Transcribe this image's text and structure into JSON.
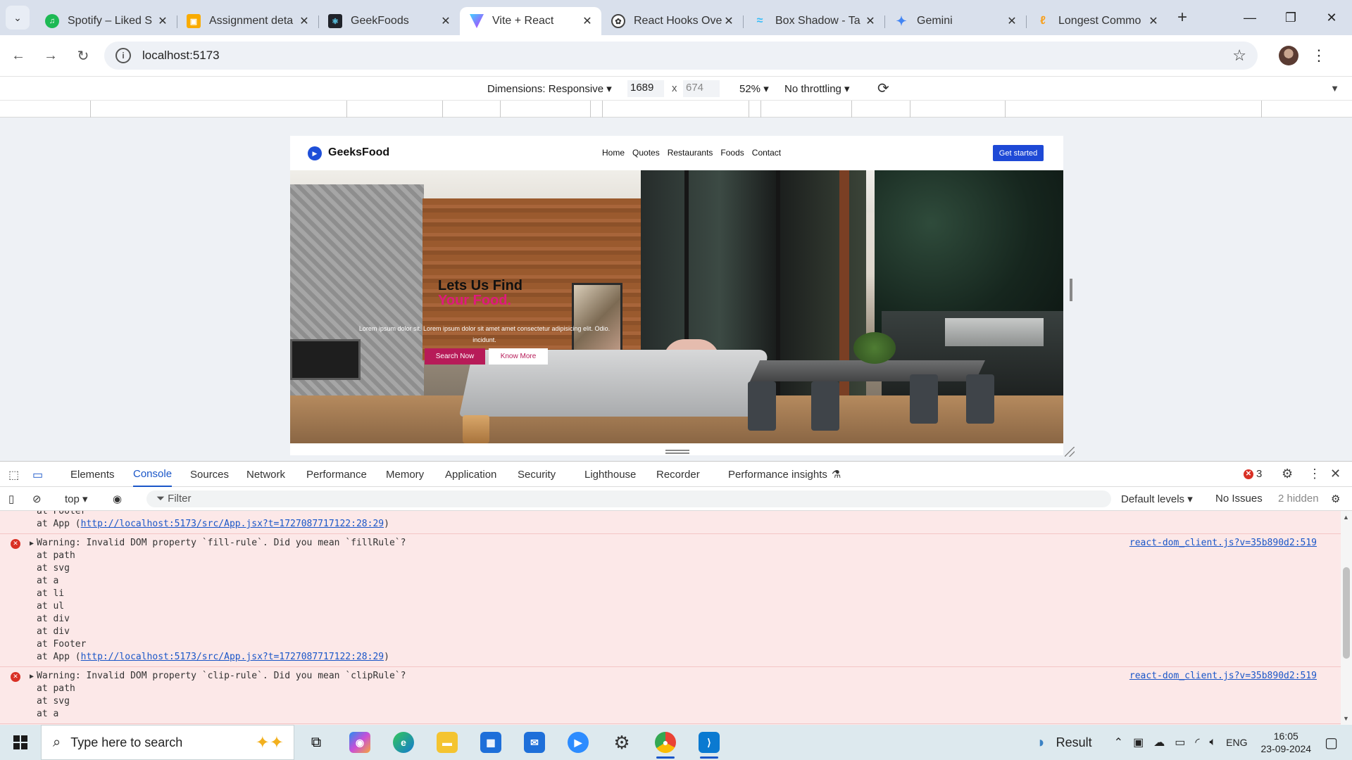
{
  "browser": {
    "tabs": [
      {
        "title": "Spotify – Liked S",
        "icon": "spotify-icon",
        "color": "#1db954"
      },
      {
        "title": "Assignment deta",
        "icon": "classroom-icon",
        "color": "#f9ab00"
      },
      {
        "title": "GeekFoods",
        "icon": "react-icon",
        "color": "#20232a"
      },
      {
        "title": "Vite + React",
        "icon": "vite-icon",
        "color": "#a855f7"
      },
      {
        "title": "React Hooks Ove",
        "icon": "openai-icon",
        "color": "#444444"
      },
      {
        "title": "Box Shadow - Ta",
        "icon": "tailwind-icon",
        "color": "#38bdf8"
      },
      {
        "title": "Gemini",
        "icon": "gemini-icon",
        "color": "#4285f4"
      },
      {
        "title": "Longest Commo",
        "icon": "leetcode-icon",
        "color": "#f89f1b"
      }
    ],
    "url": "localhost:5173"
  },
  "device_toolbar": {
    "dimensions_label": "Dimensions: Responsive",
    "width": "1689",
    "height": "674",
    "times": "x",
    "zoom": "52%",
    "throttling": "No throttling"
  },
  "site": {
    "logo": "GeeksFood",
    "nav": [
      "Home",
      "Quotes",
      "Restaurants",
      "Foods",
      "Contact"
    ],
    "cta": "Get started",
    "hero": {
      "heading": "Lets Us Find",
      "accent": "Your Food.",
      "text": "Lorem ipsum dolor sit. Lorem ipsum dolor sit amet amet consectetur adipisicing elit. Odio. incidunt.",
      "primary_button": "Search Now",
      "secondary_button": "Know More"
    }
  },
  "devtools": {
    "tabs": [
      "Elements",
      "Console",
      "Sources",
      "Network",
      "Performance",
      "Memory",
      "Application",
      "Security",
      "Lighthouse",
      "Recorder",
      "Performance insights"
    ],
    "active_tab": "Console",
    "error_count": "3",
    "context": "top",
    "filter_placeholder": "Filter",
    "levels": "Default levels",
    "issues": "No Issues",
    "hidden": "2 hidden",
    "partial_lines": [
      "at Footer",
      "at App ("
    ],
    "partial_link": "http://localhost:5173/src/App.jsx?t=1727087717122:28:29",
    "entries": [
      {
        "message": "Warning: Invalid DOM property `fill-rule`. Did you mean `fillRule`?",
        "source": "react-dom_client.js?v=35b890d2:519",
        "stack": [
          "at path",
          "at svg",
          "at a",
          "at li",
          "at ul",
          "at div",
          "at div",
          "at Footer",
          "at App ("
        ],
        "link": "http://localhost:5173/src/App.jsx?t=1727087717122:28:29"
      },
      {
        "message": "Warning: Invalid DOM property `clip-rule`. Did you mean `clipRule`?",
        "source": "react-dom_client.js?v=35b890d2:519",
        "stack": [
          "at path",
          "at svg",
          "at a"
        ]
      }
    ]
  },
  "taskbar": {
    "search_placeholder": "Type here to search",
    "weather": "Result",
    "language": "ENG",
    "time": "16:05",
    "date": "23-09-2024"
  }
}
